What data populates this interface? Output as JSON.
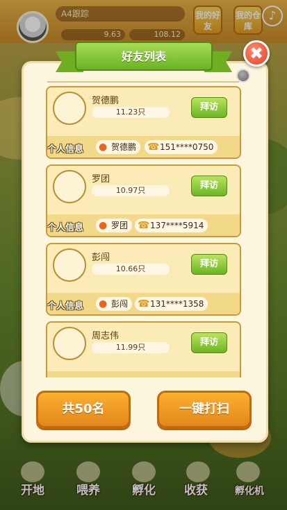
{
  "header": {
    "username": "A4跟踪",
    "stat_left": "9.63",
    "stat_right": "108.12",
    "btn_friend": "我的好友",
    "btn_warehouse": "我的仓库",
    "music_icon": "♪"
  },
  "modal": {
    "title": "好友列表",
    "close_icon": "✖",
    "info_label": "个人信息",
    "visit_label": "拜访",
    "friends": [
      {
        "name": "贺德鹏",
        "weight": "11.23只",
        "contact": "贺德鹏",
        "phone": "151****0750"
      },
      {
        "name": "罗团",
        "weight": "10.97只",
        "contact": "罗团",
        "phone": "137****5914"
      },
      {
        "name": "彭闯",
        "weight": "10.66只",
        "contact": "彭闯",
        "phone": "131****1358"
      },
      {
        "name": "周志伟",
        "weight": "11.99只",
        "contact": "",
        "phone": ""
      }
    ],
    "total_button": "共50名",
    "sweep_button": "一键打扫"
  },
  "bottom_nav": [
    "开地",
    "喂养",
    "孵化",
    "收获",
    "孵化机"
  ],
  "colors": {
    "accent_green": "#6bb224",
    "accent_orange": "#e2871a",
    "close_red": "#e2412a"
  }
}
